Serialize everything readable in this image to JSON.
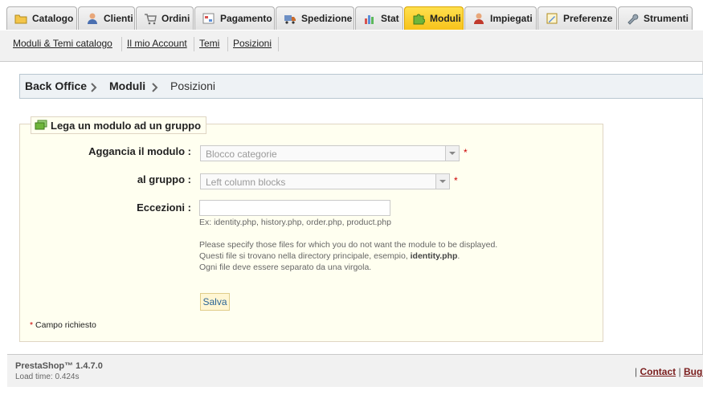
{
  "tabs": [
    {
      "label": "Catalogo",
      "icon": "folder-icon"
    },
    {
      "label": "Clienti",
      "icon": "user-icon"
    },
    {
      "label": "Ordini",
      "icon": "cart-icon"
    },
    {
      "label": "Pagamento",
      "icon": "payment-icon"
    },
    {
      "label": "Spedizione",
      "icon": "truck-icon"
    },
    {
      "label": "Stat",
      "icon": "chart-icon"
    },
    {
      "label": "Moduli",
      "icon": "puzzle-icon",
      "active": true
    },
    {
      "label": "Impiegati",
      "icon": "employee-icon"
    },
    {
      "label": "Preferenze",
      "icon": "preferences-icon"
    },
    {
      "label": "Strumenti",
      "icon": "wrench-icon"
    }
  ],
  "subnav": [
    "Moduli & Temi catalogo",
    "Il mio Account",
    "Temi",
    "Posizioni"
  ],
  "breadcrumb": {
    "root": "Back Office",
    "section": "Moduli",
    "current": "Posizioni"
  },
  "form": {
    "legend": "Lega un modulo ad un gruppo",
    "module_label": "Aggancia il modulo :",
    "module_value": "Blocco categorie",
    "group_label": "al gruppo :",
    "group_value": "Left column blocks",
    "exceptions_label": "Eccezioni :",
    "exceptions_value": "",
    "hint_example": "Ex: identity.php, history.php, order.php, product.php",
    "hint_line1": "Please specify those files for which you do not want the module to be displayed.",
    "hint_line2_pre": "Questi file si trovano nella directory principale, esempio,",
    "hint_line2_file": "identity.php",
    "hint_line2_post": ".",
    "hint_line3": "Ogni file deve essere separato da una virgola.",
    "required_mark": "*",
    "save_label": "Salva",
    "required_note": "Campo richiesto"
  },
  "footer": {
    "version": "PrestaShop™ 1.4.7.0",
    "load_time": "Load time: 0.424s",
    "separator": "|",
    "contact": "Contact",
    "bug": "Bug T"
  },
  "colors": {
    "active_tab": "#f7c21b",
    "required": "#cc0000",
    "link": "#2a6496"
  }
}
